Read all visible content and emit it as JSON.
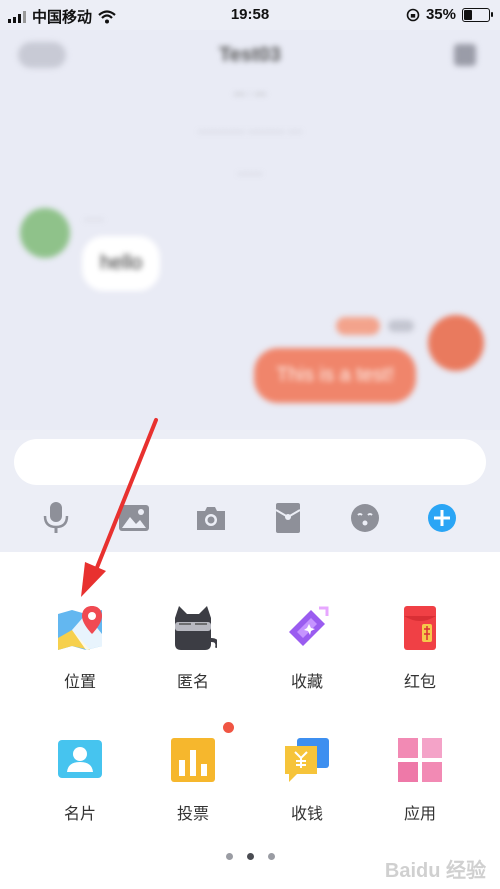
{
  "status_bar": {
    "carrier": "中国移动",
    "time": "19:58",
    "battery_percent": "35%",
    "battery_level": 0.35,
    "icons": [
      "signal-icon",
      "wifi-icon",
      "rotation-lock-icon",
      "battery-icon"
    ]
  },
  "chat": {
    "title": "Test03",
    "messages": {
      "incoming": "hello",
      "outgoing": "This is a test!"
    }
  },
  "input_bar": {
    "placeholder": "",
    "tools": [
      "microphone-icon",
      "image-icon",
      "camera-icon",
      "red-packet-icon",
      "emoji-icon",
      "plus-icon"
    ]
  },
  "plugins": [
    {
      "label": "位置",
      "icon": "location-icon"
    },
    {
      "label": "匿名",
      "icon": "anonymous-icon"
    },
    {
      "label": "收藏",
      "icon": "favorite-icon"
    },
    {
      "label": "红包",
      "icon": "red-packet-icon"
    },
    {
      "label": "名片",
      "icon": "contact-card-icon"
    },
    {
      "label": "投票",
      "icon": "vote-icon",
      "badge": true
    },
    {
      "label": "收钱",
      "icon": "receive-money-icon"
    },
    {
      "label": "应用",
      "icon": "apps-icon"
    }
  ],
  "pager": {
    "pages": 3,
    "current": 2
  },
  "watermark": "Baidu 经验",
  "colors": {
    "accent_blue": "#2aa5f5",
    "badge_red": "#f05543",
    "annotation_arrow": "#e8312f"
  }
}
